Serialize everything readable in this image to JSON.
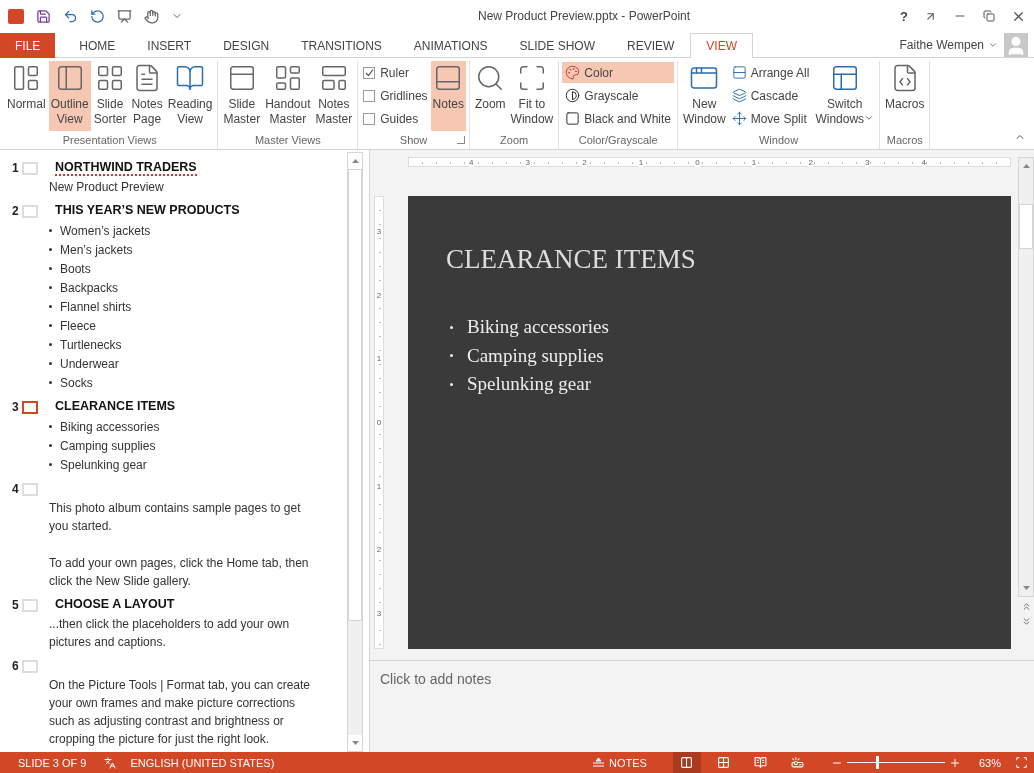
{
  "window": {
    "title": "New Product Preview.pptx - PowerPoint",
    "help": "?"
  },
  "tabs": [
    {
      "label": "FILE",
      "kind": "file",
      "selected": false
    },
    {
      "label": "HOME",
      "kind": "tab",
      "selected": false
    },
    {
      "label": "INSERT",
      "kind": "tab",
      "selected": false
    },
    {
      "label": "DESIGN",
      "kind": "tab",
      "selected": false
    },
    {
      "label": "TRANSITIONS",
      "kind": "tab",
      "selected": false
    },
    {
      "label": "ANIMATIONS",
      "kind": "tab",
      "selected": false
    },
    {
      "label": "SLIDE SHOW",
      "kind": "tab",
      "selected": false
    },
    {
      "label": "REVIEW",
      "kind": "tab",
      "selected": false
    },
    {
      "label": "VIEW",
      "kind": "tab",
      "selected": true
    }
  ],
  "user": {
    "name": "Faithe Wempen"
  },
  "ribbon": {
    "groups": [
      {
        "label": "Presentation Views",
        "launcher": false,
        "items": [
          {
            "kind": "large",
            "label": "Normal",
            "selected": false
          },
          {
            "kind": "large",
            "label": "Outline\nView",
            "selected": true
          },
          {
            "kind": "large",
            "label": "Slide\nSorter",
            "selected": false
          },
          {
            "kind": "large",
            "label": "Notes\nPage",
            "selected": false
          },
          {
            "kind": "large",
            "label": "Reading\nView",
            "selected": false
          }
        ]
      },
      {
        "label": "Master Views",
        "launcher": false,
        "items": [
          {
            "kind": "large",
            "label": "Slide\nMaster",
            "selected": false
          },
          {
            "kind": "large",
            "label": "Handout\nMaster",
            "selected": false
          },
          {
            "kind": "large",
            "label": "Notes\nMaster",
            "selected": false
          }
        ]
      },
      {
        "label": "Show",
        "launcher": true,
        "items": [
          {
            "kind": "check",
            "label": "Ruler",
            "checked": true
          },
          {
            "kind": "check",
            "label": "Gridlines",
            "checked": false
          },
          {
            "kind": "check",
            "label": "Guides",
            "checked": false
          },
          {
            "kind": "large",
            "label": "Notes",
            "selected": true
          }
        ]
      },
      {
        "label": "Zoom",
        "launcher": false,
        "items": [
          {
            "kind": "large",
            "label": "Zoom",
            "selected": false
          },
          {
            "kind": "large",
            "label": "Fit to\nWindow",
            "selected": false
          }
        ]
      },
      {
        "label": "Color/Grayscale",
        "launcher": false,
        "items": [
          {
            "kind": "small",
            "label": "Color",
            "selected": true
          },
          {
            "kind": "small",
            "label": "Grayscale",
            "selected": false
          },
          {
            "kind": "small",
            "label": "Black and White",
            "selected": false
          }
        ]
      },
      {
        "label": "Window",
        "launcher": false,
        "items": [
          {
            "kind": "large",
            "label": "New\nWindow",
            "selected": false
          },
          {
            "kind": "small",
            "label": "Arrange All",
            "selected": false
          },
          {
            "kind": "small",
            "label": "Cascade",
            "selected": false
          },
          {
            "kind": "small",
            "label": "Move Split",
            "selected": false
          },
          {
            "kind": "large",
            "label": "Switch\nWindows",
            "selected": false,
            "dropdown": true
          }
        ]
      },
      {
        "label": "Macros",
        "launcher": false,
        "items": [
          {
            "kind": "large",
            "label": "Macros",
            "selected": false
          }
        ]
      }
    ]
  },
  "outline": {
    "slides": [
      {
        "number": "1",
        "selected": false,
        "title": "NORTHWIND TRADERS",
        "misspelled": true,
        "content": [
          {
            "kind": "text",
            "text": "New Product Preview"
          }
        ]
      },
      {
        "number": "2",
        "selected": false,
        "title": "THIS YEAR’S NEW PRODUCTS",
        "misspelled": false,
        "content": [
          {
            "kind": "bullet",
            "text": "Women’s jackets"
          },
          {
            "kind": "bullet",
            "text": "Men’s jackets"
          },
          {
            "kind": "bullet",
            "text": "Boots"
          },
          {
            "kind": "bullet",
            "text": "Backpacks"
          },
          {
            "kind": "bullet",
            "text": "Flannel shirts"
          },
          {
            "kind": "bullet",
            "text": "Fleece"
          },
          {
            "kind": "bullet",
            "text": "Turtlenecks"
          },
          {
            "kind": "bullet",
            "text": "Underwear"
          },
          {
            "kind": "bullet",
            "text": "Socks"
          }
        ]
      },
      {
        "number": "3",
        "selected": true,
        "title": "CLEARANCE ITEMS",
        "misspelled": false,
        "content": [
          {
            "kind": "bullet",
            "text": "Biking accessories"
          },
          {
            "kind": "bullet",
            "text": "Camping supplies"
          },
          {
            "kind": "bullet",
            "text": "Spelunking gear"
          }
        ]
      },
      {
        "number": "4",
        "selected": false,
        "content": [
          {
            "kind": "text",
            "text": "This photo album contains sample pages to get you started."
          },
          {
            "kind": "gap"
          },
          {
            "kind": "text",
            "text": "To add your own pages, click the Home tab, then click the New Slide gallery."
          }
        ]
      },
      {
        "number": "5",
        "selected": false,
        "title": "CHOOSE A LAYOUT",
        "misspelled": false,
        "content": [
          {
            "kind": "text",
            "text": "...then click the placeholders to add your own pictures and captions."
          }
        ]
      },
      {
        "number": "6",
        "selected": false,
        "content": [
          {
            "kind": "text",
            "text": "On the Picture Tools | Format tab, you can create your own frames and make picture corrections such as adjusting contrast and brightness or cropping the picture for just the right look."
          }
        ]
      }
    ]
  },
  "rulers": {
    "horizontal": [
      "4",
      "3",
      "2",
      "1",
      "0",
      "1",
      "2",
      "3",
      "4"
    ],
    "vertical": [
      "3",
      "2",
      "1",
      "0",
      "1",
      "2",
      "3"
    ]
  },
  "slide": {
    "title": "CLEARANCE ITEMS",
    "bullets": [
      "Biking accessories",
      "Camping supplies",
      "Spelunking gear"
    ]
  },
  "notes": {
    "placeholder": "Click to add notes"
  },
  "status_bar": {
    "slide": "SLIDE 3 OF 9",
    "language": "ENGLISH (UNITED STATES)",
    "notes": "NOTES",
    "views": [
      {
        "selected": true
      },
      {
        "selected": false
      },
      {
        "selected": false
      },
      {
        "selected": false
      }
    ],
    "zoom": {
      "level": 0.31,
      "reading": "63%"
    }
  }
}
